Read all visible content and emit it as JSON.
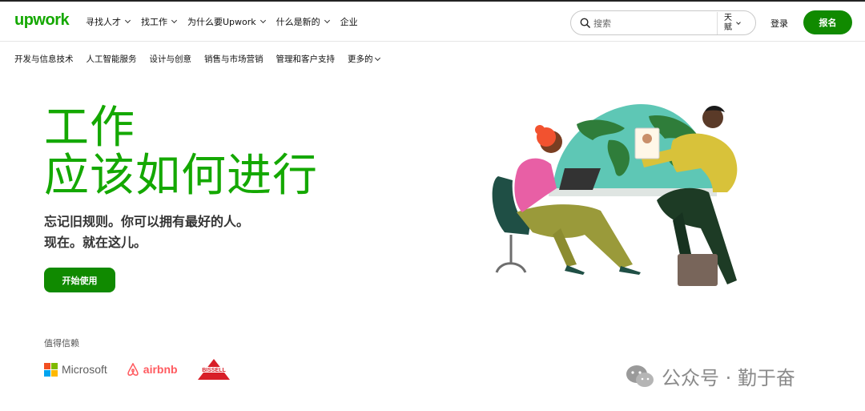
{
  "header": {
    "logo": "upwork",
    "nav": [
      {
        "label": "寻找人才"
      },
      {
        "label": "找工作"
      },
      {
        "label": "为什么要Upwork"
      },
      {
        "label": "什么是新的"
      },
      {
        "label": "企业"
      }
    ],
    "search": {
      "placeholder": "搜索",
      "scope": "天赋"
    },
    "login": "登录",
    "signup": "报名"
  },
  "categories": [
    {
      "label": "开发与信息技术"
    },
    {
      "label": "人工智能服务"
    },
    {
      "label": "设计与创意"
    },
    {
      "label": "销售与市场营销"
    },
    {
      "label": "管理和客户支持"
    },
    {
      "label": "更多的"
    }
  ],
  "hero": {
    "title_line1": "工作",
    "title_line2": "应该如何进行",
    "subtitle_line1": "忘记旧规则。你可以拥有最好的人。",
    "subtitle_line2": "现在。就在这儿。",
    "cta": "开始使用"
  },
  "trusted": {
    "label": "值得信赖",
    "brands": [
      {
        "name": "Microsoft"
      },
      {
        "name": "airbnb"
      },
      {
        "name": "BISSELL"
      }
    ]
  },
  "watermark": {
    "text": "公众号 · 勤于奋"
  },
  "colors": {
    "brand_green": "#14a800",
    "button_green": "#108a00"
  }
}
